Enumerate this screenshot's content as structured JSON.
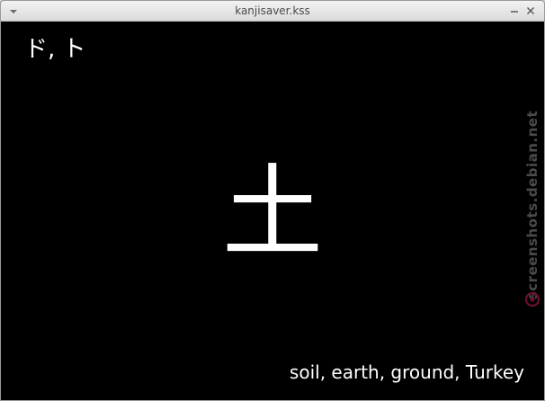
{
  "window": {
    "title": "kanjisaver.kss"
  },
  "screensaver": {
    "reading": "ド, ト",
    "kanji": "土",
    "meaning": "soil, earth, ground, Turkey"
  },
  "watermark": {
    "text": "screenshots.debian.net"
  },
  "icons": {
    "window_menu": "chevron-down-icon",
    "minimize": "minimize-icon",
    "close": "close-icon",
    "watermark_logo": "debian-swirl-icon"
  },
  "colors": {
    "background": "#000000",
    "text": "#ffffff",
    "titlebar": "#e6e6e6",
    "watermark": "#4a4a4a",
    "logo": "#c7003a"
  }
}
